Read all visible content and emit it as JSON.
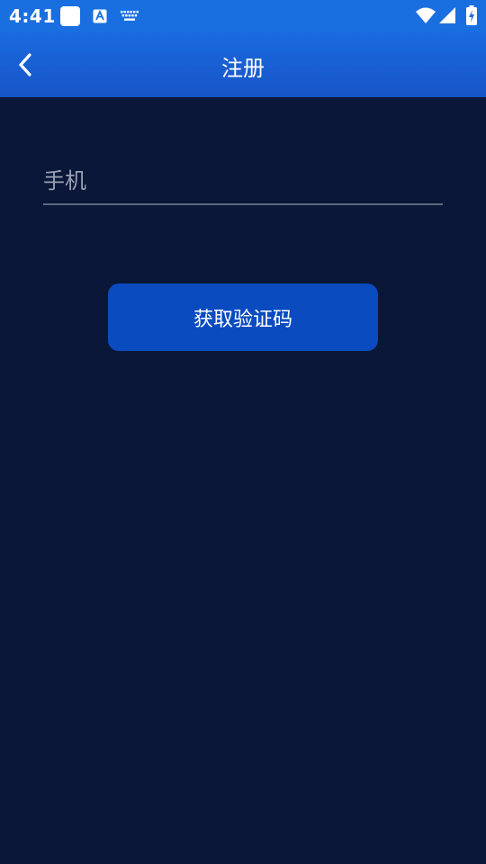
{
  "status_bar": {
    "time": "4:41",
    "icons": [
      "notification-square-icon",
      "text-a-icon",
      "keyboard-icon",
      "wifi-icon",
      "cell-signal-icon",
      "battery-charging-icon"
    ]
  },
  "app_bar": {
    "title": "注册",
    "back_icon": "chevron-left-icon"
  },
  "form": {
    "phone_placeholder": "手机",
    "phone_value": "",
    "get_code_label": "获取验证码"
  },
  "colors": {
    "status_bar": "#1a6fe0",
    "app_bar": "#1a6adf",
    "background": "#0a1738",
    "button": "#0b4bc0",
    "underline": "#5f6780",
    "placeholder": "#9aa1b3"
  }
}
